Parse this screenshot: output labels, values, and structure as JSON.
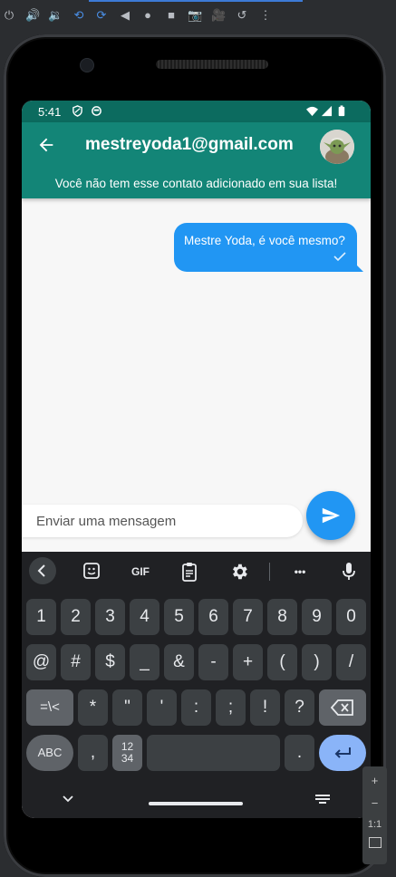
{
  "emulator": {
    "toolbar_icons": [
      "power-icon",
      "volume-up-icon",
      "volume-down-icon",
      "rotate-left-icon",
      "rotate-right-icon",
      "back-icon",
      "home-icon",
      "overview-icon",
      "screenshot-icon",
      "screenrecord-icon",
      "snapshot-icon",
      "more-icon"
    ],
    "side_toolbar": {
      "zoom_in": "+",
      "zoom_out": "−",
      "ratio": "1:1"
    }
  },
  "status_bar": {
    "time": "5:41"
  },
  "app_bar": {
    "title": "mestreyoda1@gmail.com",
    "notice": "Você não tem esse contato adicionado em sua lista!",
    "color": "#138577"
  },
  "messages": [
    {
      "text": "Mestre Yoda, é você mesmo?",
      "sent": true,
      "status": "read-check-icon"
    }
  ],
  "composer": {
    "placeholder": "Enviar uma mensagem"
  },
  "keyboard": {
    "toolbar": {
      "gif": "GIF",
      "more": "•••"
    },
    "row1": [
      "1",
      "2",
      "3",
      "4",
      "5",
      "6",
      "7",
      "8",
      "9",
      "0"
    ],
    "row2": [
      "@",
      "#",
      "$",
      "_",
      "&",
      "-",
      "+",
      "(",
      ")",
      "/"
    ],
    "row3": [
      "=\\<",
      "*",
      "\"",
      "'",
      ":",
      ";",
      "!",
      "?"
    ],
    "row4": {
      "abc": "ABC",
      "comma": ",",
      "numpad": "12\n34",
      "period": "."
    }
  },
  "colors": {
    "accent": "#2196f3",
    "status_bar": "#0c6b5f"
  }
}
